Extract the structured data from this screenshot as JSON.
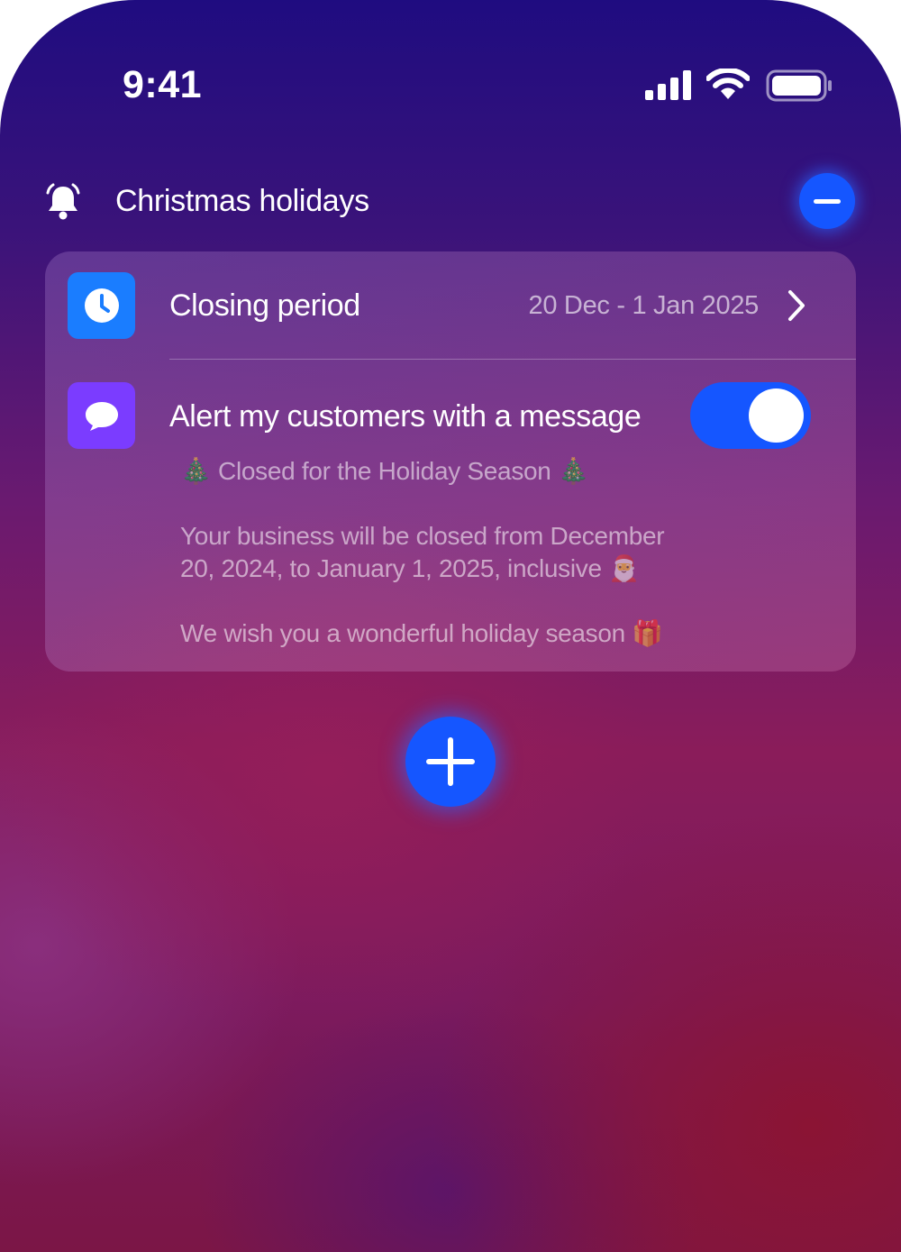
{
  "status_bar": {
    "time": "9:41",
    "icons": [
      "cellular-signal-icon",
      "wifi-icon",
      "battery-icon"
    ]
  },
  "section": {
    "icon": "bell-icon",
    "title": "Christmas holidays",
    "remove_icon": "minus-icon"
  },
  "card": {
    "closing_period": {
      "icon": "clock-icon",
      "label": "Closing period",
      "value": "20 Dec - 1 Jan 2025",
      "chevron_icon": "chevron-right-icon"
    },
    "alert": {
      "icon": "chat-bubble-icon",
      "label": "Alert my customers with a message",
      "toggle_on": true,
      "message": {
        "heading": "🎄 Closed for the Holiday Season 🎄",
        "line_1": "Your business will be closed from December",
        "line_2": "20, 2024, to January 1, 2025, inclusive 🎅",
        "line_3": "We wish you a wonderful holiday season 🎁"
      }
    }
  },
  "add_button_icon": "plus-icon",
  "colors": {
    "accent_blue": "#1556ff",
    "clock_tile": "#1a7dff",
    "chat_tile": "#7b3cff"
  }
}
